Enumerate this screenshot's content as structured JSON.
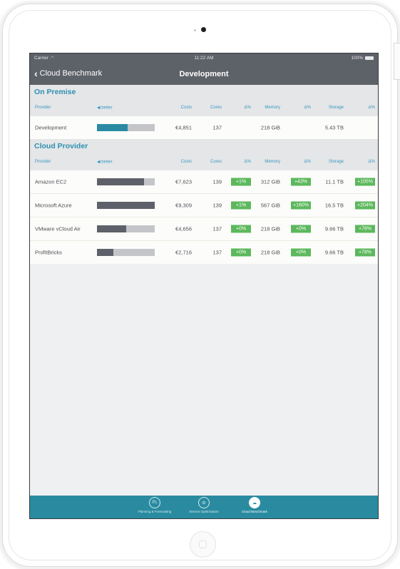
{
  "status_bar": {
    "carrier": "Carrier",
    "time": "11:22 AM",
    "battery": "100%"
  },
  "nav": {
    "back_label": "Cloud Benchmark",
    "title": "Development"
  },
  "columns": {
    "provider": "Provider",
    "better": "better",
    "costs": "Costs",
    "cores": "Cores",
    "delta1": "Δ%",
    "memory": "Memory",
    "delta2": "Δ%",
    "storage": "Storage",
    "delta3": "Δ%"
  },
  "on_premise": {
    "title": "On Premise",
    "rows": [
      {
        "provider": "Development",
        "bar_fill": 0.53,
        "bar_color": "#2a8aa3",
        "costs": "€4,851",
        "cores": "137",
        "cores_delta": "",
        "memory": "218 GiB",
        "memory_delta": "",
        "storage": "5.43 TB",
        "storage_delta": ""
      }
    ]
  },
  "cloud": {
    "title": "Cloud Provider",
    "rows": [
      {
        "provider": "Amazon EC2",
        "bar_fill": 0.82,
        "bar_color": "#5e6169",
        "costs": "€7,623",
        "cores": "139",
        "cores_delta": "+1%",
        "memory": "312 GiB",
        "memory_delta": "+43%",
        "storage": "11.1 TB",
        "storage_delta": "+105%"
      },
      {
        "provider": "Microsoft Azure",
        "bar_fill": 1.0,
        "bar_color": "#5e6169",
        "costs": "€9,309",
        "cores": "139",
        "cores_delta": "+1%",
        "memory": "567 GiB",
        "memory_delta": "+160%",
        "storage": "16.5 TB",
        "storage_delta": "+204%"
      },
      {
        "provider": "VMware vCloud Air",
        "bar_fill": 0.5,
        "bar_color": "#5e6169",
        "costs": "€4,656",
        "cores": "137",
        "cores_delta": "+0%",
        "memory": "218 GiB",
        "memory_delta": "+0%",
        "storage": "9.66 TB",
        "storage_delta": "+78%"
      },
      {
        "provider": "ProfitBricks",
        "bar_fill": 0.29,
        "bar_color": "#5e6169",
        "costs": "€2,716",
        "cores": "137",
        "cores_delta": "+0%",
        "memory": "218 GiB",
        "memory_delta": "+0%",
        "storage": "9.66 TB",
        "storage_delta": "+78%"
      }
    ]
  },
  "tabs": [
    {
      "label": "Planning & Forecasting",
      "icon": "planning-icon",
      "active": false
    },
    {
      "label": "Service Optimization",
      "icon": "optimization-icon",
      "active": false
    },
    {
      "label": "Cloud Benchmark",
      "icon": "cloud-icon",
      "active": true
    }
  ],
  "colors": {
    "accent": "#2f8fb1",
    "header": "#5d6168",
    "tabbar": "#2a8ba0",
    "delta_badge": "#5cb85c"
  }
}
